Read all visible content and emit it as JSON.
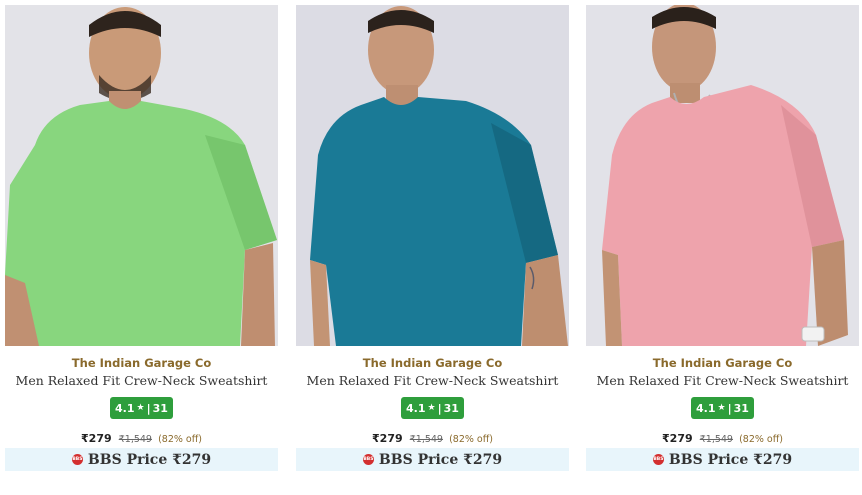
{
  "products": [
    {
      "brand": "The Indian Garage Co",
      "title": "Men Relaxed Fit Crew-Neck Sweatshirt",
      "rating": "4.1",
      "reviews": "31",
      "price": "₹279",
      "mrp": "₹1,549",
      "discount": "(82% off)",
      "bbs_label": "BBS Price ₹279",
      "bbs_icon_text": "BBS",
      "shirt_color": "#88d67e",
      "shirt_shadow": "#6dbb63"
    },
    {
      "brand": "The Indian Garage Co",
      "title": "Men Relaxed Fit Crew-Neck Sweatshirt",
      "rating": "4.1",
      "reviews": "31",
      "price": "₹279",
      "mrp": "₹1,549",
      "discount": "(82% off)",
      "bbs_label": "BBS Price ₹279",
      "bbs_icon_text": "BBS",
      "shirt_color": "#1a7a96",
      "shirt_shadow": "#135d74"
    },
    {
      "brand": "The Indian Garage Co",
      "title": "Men Relaxed Fit Crew-Neck Sweatshirt",
      "rating": "4.1",
      "reviews": "31",
      "price": "₹279",
      "mrp": "₹1,549",
      "discount": "(82% off)",
      "bbs_label": "BBS Price ₹279",
      "bbs_icon_text": "BBS",
      "shirt_color": "#eea3ac",
      "shirt_shadow": "#d7878f"
    }
  ],
  "rating_separator": "|",
  "star_icon": "★",
  "colors": {
    "brand_text": "#8a6a2c",
    "rating_badge": "#2e9e3c",
    "bbs_background": "#e8f5fb",
    "bbs_icon": "#d32f2f"
  }
}
